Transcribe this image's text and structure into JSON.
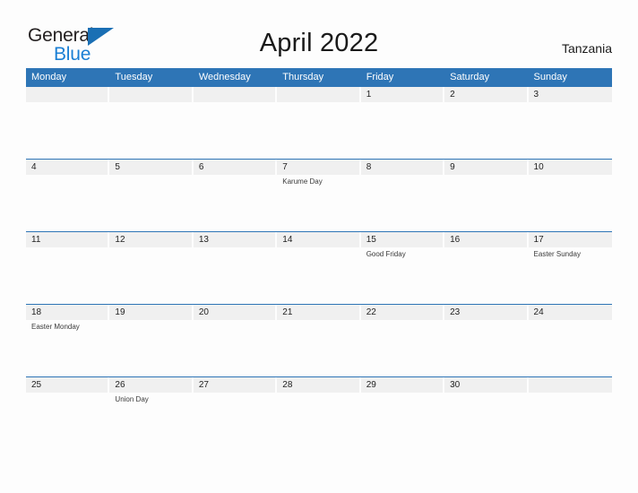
{
  "brand": {
    "name_top": "General",
    "name_bottom": "Blue",
    "triangle_icon": "blue-triangle-icon",
    "color_dark": "#231f20",
    "color_blue": "#1a7fd4",
    "color_triangle": "#1a6fb4"
  },
  "header": {
    "title": "April 2022",
    "country": "Tanzania",
    "accent_color": "#2e75b6"
  },
  "calendar": {
    "weekdays": [
      "Monday",
      "Tuesday",
      "Wednesday",
      "Thursday",
      "Friday",
      "Saturday",
      "Sunday"
    ],
    "band_color": "#f0f0f0",
    "weeks": [
      [
        {
          "day": "",
          "event": ""
        },
        {
          "day": "",
          "event": ""
        },
        {
          "day": "",
          "event": ""
        },
        {
          "day": "",
          "event": ""
        },
        {
          "day": "1",
          "event": ""
        },
        {
          "day": "2",
          "event": ""
        },
        {
          "day": "3",
          "event": ""
        }
      ],
      [
        {
          "day": "4",
          "event": ""
        },
        {
          "day": "5",
          "event": ""
        },
        {
          "day": "6",
          "event": ""
        },
        {
          "day": "7",
          "event": "Karume Day"
        },
        {
          "day": "8",
          "event": ""
        },
        {
          "day": "9",
          "event": ""
        },
        {
          "day": "10",
          "event": ""
        }
      ],
      [
        {
          "day": "11",
          "event": ""
        },
        {
          "day": "12",
          "event": ""
        },
        {
          "day": "13",
          "event": ""
        },
        {
          "day": "14",
          "event": ""
        },
        {
          "day": "15",
          "event": "Good Friday"
        },
        {
          "day": "16",
          "event": ""
        },
        {
          "day": "17",
          "event": "Easter Sunday"
        }
      ],
      [
        {
          "day": "18",
          "event": "Easter Monday"
        },
        {
          "day": "19",
          "event": ""
        },
        {
          "day": "20",
          "event": ""
        },
        {
          "day": "21",
          "event": ""
        },
        {
          "day": "22",
          "event": ""
        },
        {
          "day": "23",
          "event": ""
        },
        {
          "day": "24",
          "event": ""
        }
      ],
      [
        {
          "day": "25",
          "event": ""
        },
        {
          "day": "26",
          "event": "Union Day"
        },
        {
          "day": "27",
          "event": ""
        },
        {
          "day": "28",
          "event": ""
        },
        {
          "day": "29",
          "event": ""
        },
        {
          "day": "30",
          "event": ""
        },
        {
          "day": "",
          "event": ""
        }
      ]
    ]
  }
}
